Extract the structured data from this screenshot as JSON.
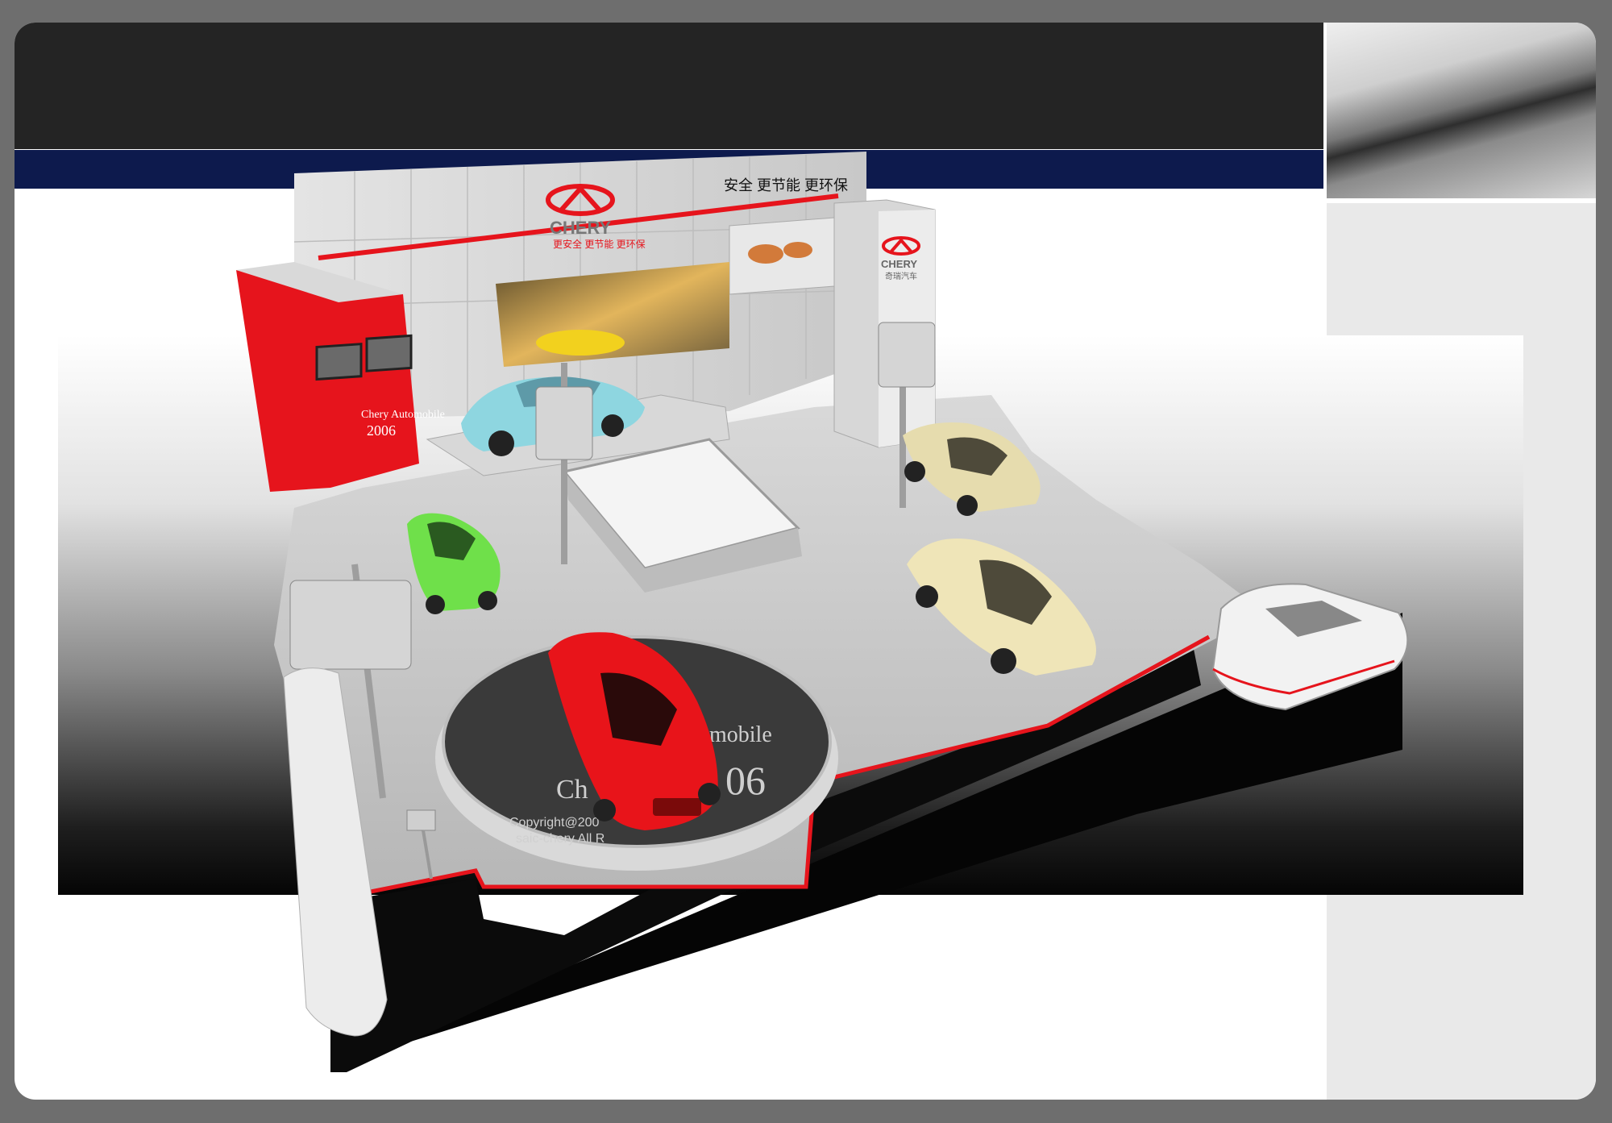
{
  "slogan": "安全 更节能 更环保",
  "brand": {
    "logo_text": "CHERY",
    "sub_text": "更安全 更节能 更环保",
    "pillar_sub": "奇瑞汽车",
    "accent_red": "#e6141c",
    "navy": "#0d1a4d"
  },
  "booth_wall": {
    "text_line1": "Chery Automobile",
    "text_line2": "2006"
  },
  "platform": {
    "text_big1": "Ch",
    "text_big2": "mobile",
    "text_big3": "06",
    "text_copy1": "Copyright@200",
    "text_copy2": "saic-chery All R"
  },
  "cars": [
    {
      "name": "blue-sedan",
      "color": "#8ed6e0"
    },
    {
      "name": "green-coupe",
      "color": "#6fe04a"
    },
    {
      "name": "red-coupe",
      "color": "#e8141a"
    },
    {
      "name": "beige-sedan-back",
      "color": "#e6dcae"
    },
    {
      "name": "beige-sedan-front",
      "color": "#efe5b8"
    }
  ],
  "icons": [
    "chery-logo-icon"
  ]
}
